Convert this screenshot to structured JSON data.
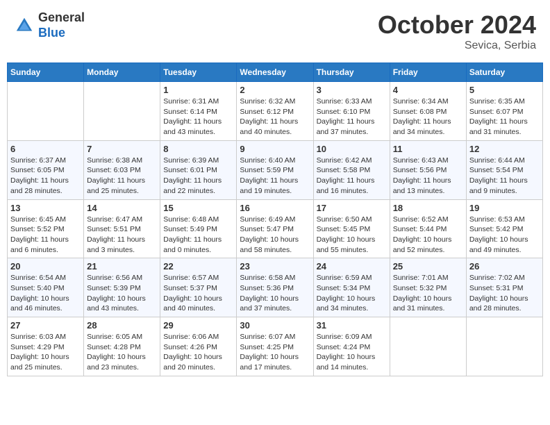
{
  "header": {
    "logo_general": "General",
    "logo_blue": "Blue",
    "month_title": "October 2024",
    "subtitle": "Sevica, Serbia"
  },
  "calendar": {
    "weekdays": [
      "Sunday",
      "Monday",
      "Tuesday",
      "Wednesday",
      "Thursday",
      "Friday",
      "Saturday"
    ],
    "weeks": [
      [
        {
          "day": "",
          "info": ""
        },
        {
          "day": "",
          "info": ""
        },
        {
          "day": "1",
          "info": "Sunrise: 6:31 AM\nSunset: 6:14 PM\nDaylight: 11 hours and 43 minutes."
        },
        {
          "day": "2",
          "info": "Sunrise: 6:32 AM\nSunset: 6:12 PM\nDaylight: 11 hours and 40 minutes."
        },
        {
          "day": "3",
          "info": "Sunrise: 6:33 AM\nSunset: 6:10 PM\nDaylight: 11 hours and 37 minutes."
        },
        {
          "day": "4",
          "info": "Sunrise: 6:34 AM\nSunset: 6:08 PM\nDaylight: 11 hours and 34 minutes."
        },
        {
          "day": "5",
          "info": "Sunrise: 6:35 AM\nSunset: 6:07 PM\nDaylight: 11 hours and 31 minutes."
        }
      ],
      [
        {
          "day": "6",
          "info": "Sunrise: 6:37 AM\nSunset: 6:05 PM\nDaylight: 11 hours and 28 minutes."
        },
        {
          "day": "7",
          "info": "Sunrise: 6:38 AM\nSunset: 6:03 PM\nDaylight: 11 hours and 25 minutes."
        },
        {
          "day": "8",
          "info": "Sunrise: 6:39 AM\nSunset: 6:01 PM\nDaylight: 11 hours and 22 minutes."
        },
        {
          "day": "9",
          "info": "Sunrise: 6:40 AM\nSunset: 5:59 PM\nDaylight: 11 hours and 19 minutes."
        },
        {
          "day": "10",
          "info": "Sunrise: 6:42 AM\nSunset: 5:58 PM\nDaylight: 11 hours and 16 minutes."
        },
        {
          "day": "11",
          "info": "Sunrise: 6:43 AM\nSunset: 5:56 PM\nDaylight: 11 hours and 13 minutes."
        },
        {
          "day": "12",
          "info": "Sunrise: 6:44 AM\nSunset: 5:54 PM\nDaylight: 11 hours and 9 minutes."
        }
      ],
      [
        {
          "day": "13",
          "info": "Sunrise: 6:45 AM\nSunset: 5:52 PM\nDaylight: 11 hours and 6 minutes."
        },
        {
          "day": "14",
          "info": "Sunrise: 6:47 AM\nSunset: 5:51 PM\nDaylight: 11 hours and 3 minutes."
        },
        {
          "day": "15",
          "info": "Sunrise: 6:48 AM\nSunset: 5:49 PM\nDaylight: 11 hours and 0 minutes."
        },
        {
          "day": "16",
          "info": "Sunrise: 6:49 AM\nSunset: 5:47 PM\nDaylight: 10 hours and 58 minutes."
        },
        {
          "day": "17",
          "info": "Sunrise: 6:50 AM\nSunset: 5:45 PM\nDaylight: 10 hours and 55 minutes."
        },
        {
          "day": "18",
          "info": "Sunrise: 6:52 AM\nSunset: 5:44 PM\nDaylight: 10 hours and 52 minutes."
        },
        {
          "day": "19",
          "info": "Sunrise: 6:53 AM\nSunset: 5:42 PM\nDaylight: 10 hours and 49 minutes."
        }
      ],
      [
        {
          "day": "20",
          "info": "Sunrise: 6:54 AM\nSunset: 5:40 PM\nDaylight: 10 hours and 46 minutes."
        },
        {
          "day": "21",
          "info": "Sunrise: 6:56 AM\nSunset: 5:39 PM\nDaylight: 10 hours and 43 minutes."
        },
        {
          "day": "22",
          "info": "Sunrise: 6:57 AM\nSunset: 5:37 PM\nDaylight: 10 hours and 40 minutes."
        },
        {
          "day": "23",
          "info": "Sunrise: 6:58 AM\nSunset: 5:36 PM\nDaylight: 10 hours and 37 minutes."
        },
        {
          "day": "24",
          "info": "Sunrise: 6:59 AM\nSunset: 5:34 PM\nDaylight: 10 hours and 34 minutes."
        },
        {
          "day": "25",
          "info": "Sunrise: 7:01 AM\nSunset: 5:32 PM\nDaylight: 10 hours and 31 minutes."
        },
        {
          "day": "26",
          "info": "Sunrise: 7:02 AM\nSunset: 5:31 PM\nDaylight: 10 hours and 28 minutes."
        }
      ],
      [
        {
          "day": "27",
          "info": "Sunrise: 6:03 AM\nSunset: 4:29 PM\nDaylight: 10 hours and 25 minutes."
        },
        {
          "day": "28",
          "info": "Sunrise: 6:05 AM\nSunset: 4:28 PM\nDaylight: 10 hours and 23 minutes."
        },
        {
          "day": "29",
          "info": "Sunrise: 6:06 AM\nSunset: 4:26 PM\nDaylight: 10 hours and 20 minutes."
        },
        {
          "day": "30",
          "info": "Sunrise: 6:07 AM\nSunset: 4:25 PM\nDaylight: 10 hours and 17 minutes."
        },
        {
          "day": "31",
          "info": "Sunrise: 6:09 AM\nSunset: 4:24 PM\nDaylight: 10 hours and 14 minutes."
        },
        {
          "day": "",
          "info": ""
        },
        {
          "day": "",
          "info": ""
        }
      ]
    ]
  }
}
